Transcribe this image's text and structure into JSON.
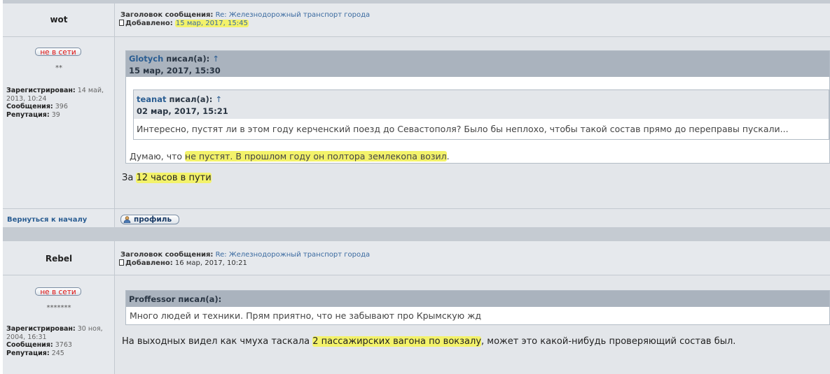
{
  "posts": [
    {
      "author": "wot",
      "subject_label": "Заголовок сообщения:",
      "subject": "Re: Железнодорожный транспорт города",
      "added_label": "Добавлено:",
      "added": "15 мар, 2017, 15:45",
      "status": "не в сети",
      "rank": "**",
      "registered_label": "Зарегистрирован:",
      "registered": "14 май, 2013, 10:24",
      "messages_label": "Сообщения:",
      "messages": "396",
      "reputation_label": "Репутация:",
      "reputation": "39",
      "quote": {
        "author": "Glotych",
        "wrote": "писал(а):",
        "arrow": "↑",
        "date": "15 мар, 2017, 15:30",
        "nested": {
          "author": "teanat",
          "wrote": "писал(а):",
          "arrow": "↑",
          "date": "02 мар, 2017, 15:21",
          "text": "Интересно, пустят ли в этом году керченский поезд до Севастополя? Было бы неплохо, чтобы такой состав прямо до переправы пускали..."
        },
        "text_plain": "Думаю, что ",
        "text_highlight": "не пустят. В прошлом году он полтора землекопа возил",
        "text_end": "."
      },
      "body_plain": "За ",
      "body_highlight": "12 часов в пути",
      "back_link": "Вернуться к началу",
      "profile_button": "профиль"
    },
    {
      "author": "Rebel",
      "subject_label": "Заголовок сообщения:",
      "subject": "Re: Железнодорожный транспорт города",
      "added_label": "Добавлено:",
      "added": "16 мар, 2017, 10:21",
      "status": "не в сети",
      "rank": "*******",
      "registered_label": "Зарегистрирован:",
      "registered": "30 ноя, 2004, 16:31",
      "messages_label": "Сообщения:",
      "messages": "3763",
      "reputation_label": "Репутация:",
      "reputation": "245",
      "quote": {
        "author": "Proffessor",
        "wrote": "писал(а):",
        "text": "Много людей и техники. Прям приятно, что не забывают про Крымскую жд"
      },
      "body_plain": "На выходных видел как чмуха таскала ",
      "body_highlight": "2 пассажирских вагона по вокзалу",
      "body_end": ", может это какой-нибудь проверяющий состав был."
    }
  ],
  "colors": {
    "highlight": "#f3f26a",
    "link": "#2a5d92",
    "offline": "#dd1111"
  }
}
